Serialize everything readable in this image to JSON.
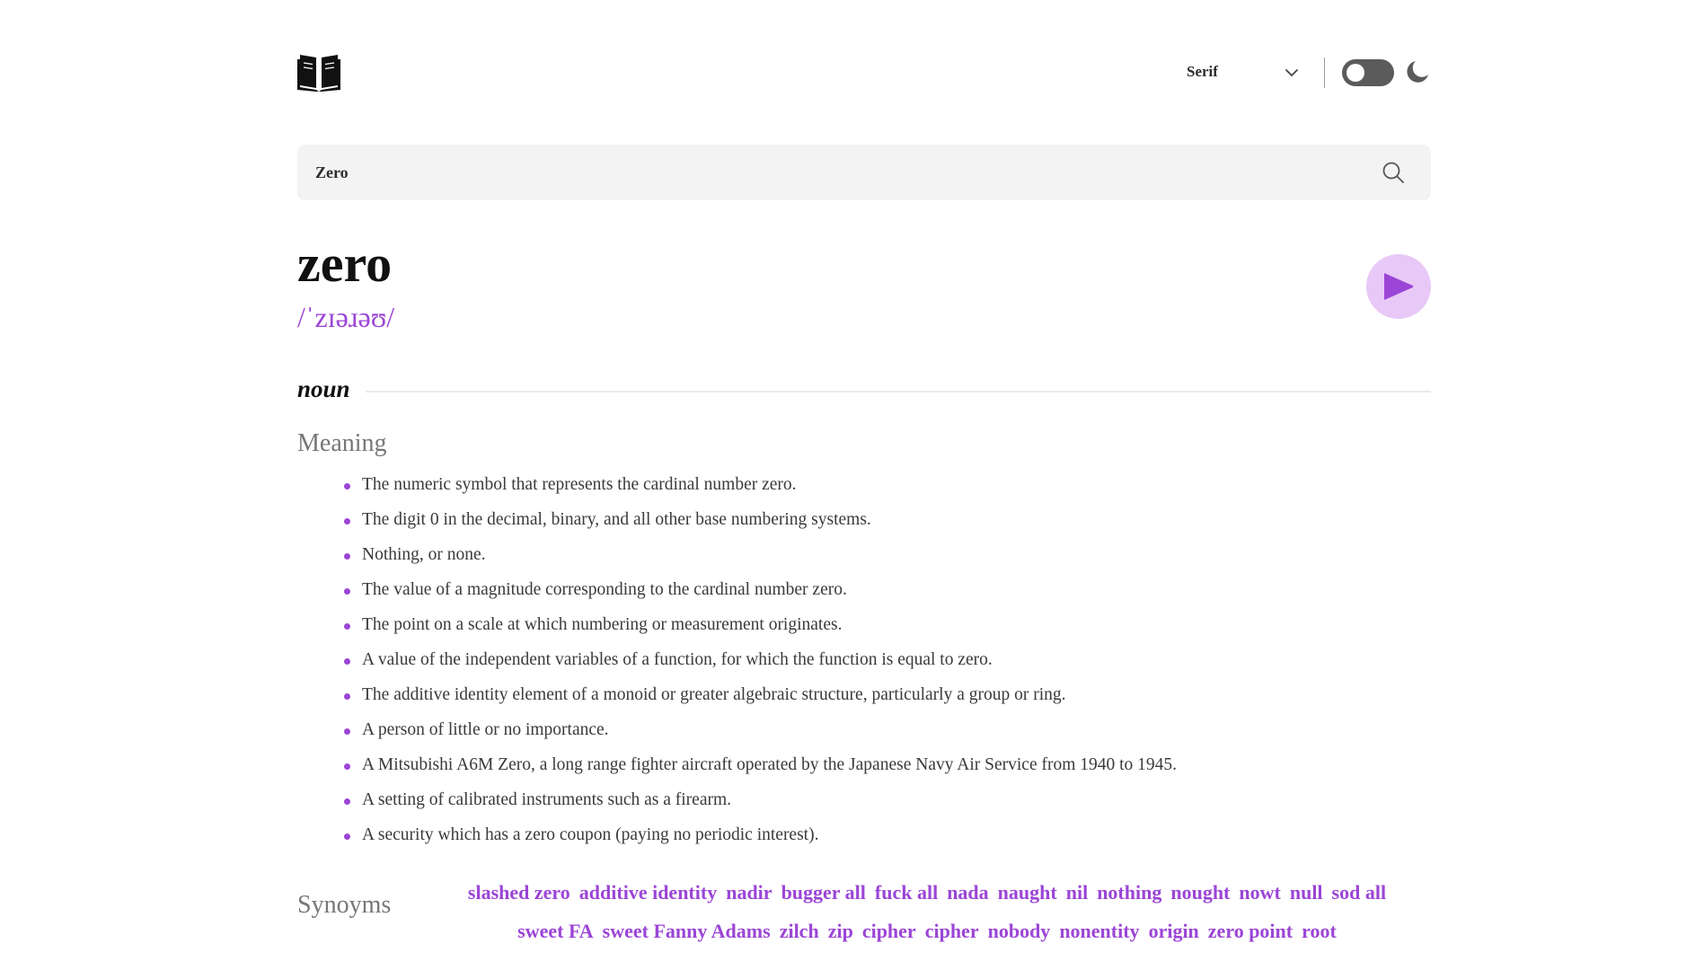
{
  "header": {
    "logo_icon": "book-icon",
    "font_select": {
      "value": "Serif",
      "icon": "chevron-down-icon"
    },
    "theme_toggle": {
      "state": "off"
    },
    "theme_icon": "moon-icon"
  },
  "search": {
    "value": "Zero",
    "icon": "search-icon"
  },
  "word": {
    "text": "zero",
    "phonetic": "/ˈzɪəɹəʊ/",
    "play_icon": "play-icon"
  },
  "meaning_section": {
    "part_of_speech": "noun",
    "title": "Meaning",
    "definitions": [
      "The numeric symbol that represents the cardinal number zero.",
      "The digit 0 in the decimal, binary, and all other base numbering systems.",
      "Nothing, or none.",
      "The value of a magnitude corresponding to the cardinal number zero.",
      "The point on a scale at which numbering or measurement originates.",
      "A value of the independent variables of a function, for which the function is equal to zero.",
      "The additive identity element of a monoid or greater algebraic structure, particularly a group or ring.",
      "A person of little or no importance.",
      "A Mitsubishi A6M Zero, a long range fighter aircraft operated by the Japanese Navy Air Service from 1940 to 1945.",
      "A setting of calibrated instruments such as a firearm.",
      "A security which has a zero coupon (paying no periodic interest)."
    ]
  },
  "synonyms_section": {
    "title": "Synoyms",
    "items": [
      "slashed zero",
      "additive identity",
      "nadir",
      "bugger all",
      "fuck all",
      "nada",
      "naught",
      "nil",
      "nothing",
      "nought",
      "nowt",
      "null",
      "sod all",
      "sweet FA",
      "sweet Fanny Adams",
      "zilch",
      "zip",
      "cipher",
      "cipher",
      "nobody",
      "nonentity",
      "origin",
      "zero point",
      "root"
    ]
  },
  "colors": {
    "accent": "#9b45d6",
    "accent_soft": "#e8c8f7",
    "search_bg": "#f3f3f3"
  }
}
